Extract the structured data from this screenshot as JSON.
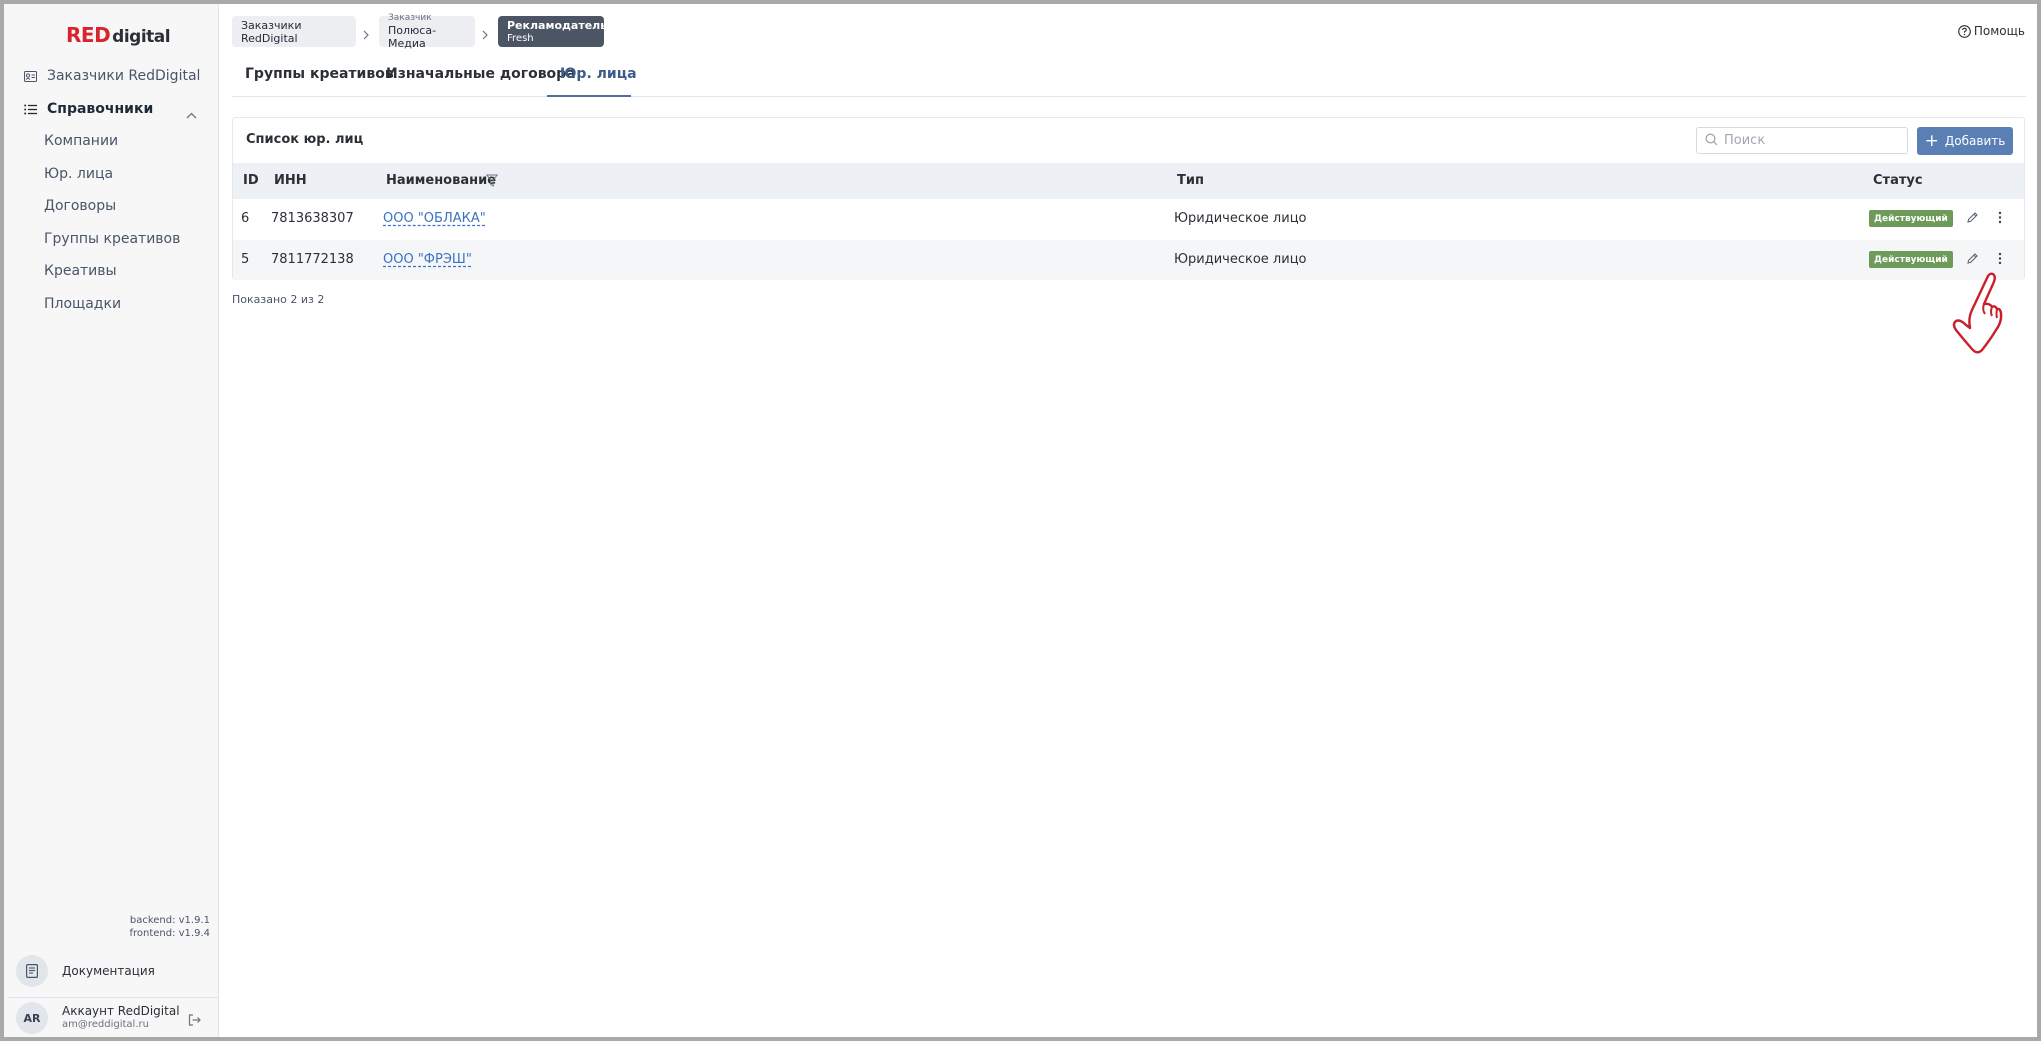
{
  "brand": {
    "logo_red": "RED",
    "logo_rest": "digital",
    "red_color": "#d9232d"
  },
  "sidebar": {
    "customers": {
      "label": "Заказчики RedDigital",
      "icon": "id-card-icon"
    },
    "references": {
      "label": "Справочники",
      "icon": "list-icon",
      "expanded": true
    },
    "sub_items": [
      {
        "label": "Компании"
      },
      {
        "label": "Юр. лица"
      },
      {
        "label": "Договоры"
      },
      {
        "label": "Группы креативов"
      },
      {
        "label": "Креативы"
      },
      {
        "label": "Площадки"
      }
    ],
    "backend_version": "backend: v1.9.1",
    "frontend_version": "frontend: v1.9.4",
    "documentation": {
      "label": "Документация",
      "icon": "book-icon"
    },
    "account": {
      "initials": "AR",
      "name": "Аккаунт RedDigital",
      "email": "am@reddigital.ru"
    }
  },
  "breadcrumbs": {
    "first": {
      "label": "Заказчики RedDigital"
    },
    "second": {
      "caption": "Заказчик",
      "label": "Полюса-Медиа"
    },
    "third": {
      "caption": "Рекламодатель",
      "label": "Fresh"
    }
  },
  "help": {
    "label": "Помощь"
  },
  "tabs": [
    {
      "label": "Группы креативов",
      "active": false
    },
    {
      "label": "Изначальные договора",
      "active": false
    },
    {
      "label": "Юр. лица",
      "active": true
    }
  ],
  "panel": {
    "title": "Список юр. лиц",
    "search_placeholder": "Поиск",
    "search_value": "",
    "add_label": "Добавить"
  },
  "table": {
    "headers": {
      "id": "ID",
      "inn": "ИНН",
      "name": "Наименование",
      "type": "Тип",
      "status": "Статус"
    },
    "rows": [
      {
        "id": "6",
        "inn": "7813638307",
        "name": "ООО \"ОБЛАКА\"",
        "type": "Юридическое лицо",
        "status": "Действующий"
      },
      {
        "id": "5",
        "inn": "7811772138",
        "name": "ООО \"ФРЭШ\"",
        "type": "Юридическое лицо",
        "status": "Действующий"
      }
    ]
  },
  "footer": {
    "shown": "Показано 2 из 2"
  },
  "colors": {
    "accent": "#5a7fb5",
    "status_green": "#6f9b5a",
    "link": "#3b72c4",
    "active_crumb": "#4b5563"
  }
}
